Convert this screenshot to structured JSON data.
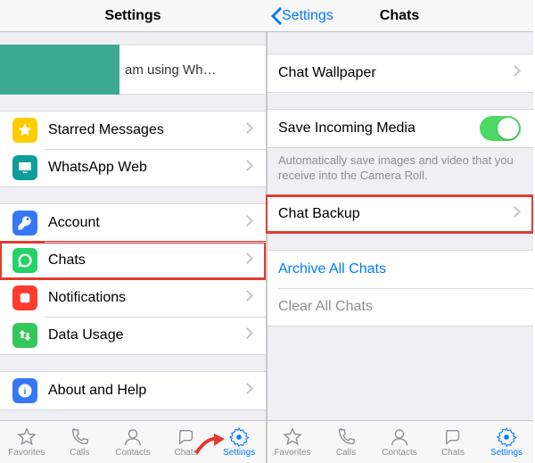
{
  "left": {
    "title": "Settings",
    "profile": {
      "status": "am using Wh…"
    },
    "group1": {
      "starred": {
        "label": "Starred Messages"
      },
      "web": {
        "label": "WhatsApp Web"
      }
    },
    "group2": {
      "account": {
        "label": "Account"
      },
      "chats": {
        "label": "Chats"
      },
      "notifications": {
        "label": "Notifications"
      },
      "datausage": {
        "label": "Data Usage"
      }
    },
    "group3": {
      "about": {
        "label": "About and Help"
      }
    },
    "tabs": {
      "favorites": "Favorites",
      "calls": "Calls",
      "contacts": "Contacts",
      "chats": "Chats",
      "settings": "Settings"
    }
  },
  "right": {
    "back_label": "Settings",
    "title": "Chats",
    "wallpaper": {
      "label": "Chat Wallpaper"
    },
    "saveMedia": {
      "label": "Save Incoming Media",
      "footer": "Automatically save images and video that you receive into the Camera Roll."
    },
    "backup": {
      "label": "Chat Backup"
    },
    "archive": "Archive All Chats",
    "clear": "Clear All Chats",
    "tabs": {
      "favorites": "Favorites",
      "calls": "Calls",
      "contacts": "Contacts",
      "chats": "Chats",
      "settings": "Settings"
    }
  },
  "colors": {
    "icons": {
      "starred": "#ffcc00",
      "web": "#0f9d9a",
      "account": "#3478f6",
      "chats": "#25d366",
      "notif": "#ff3b30",
      "data": "#34c759",
      "about": "#3478f6"
    }
  }
}
